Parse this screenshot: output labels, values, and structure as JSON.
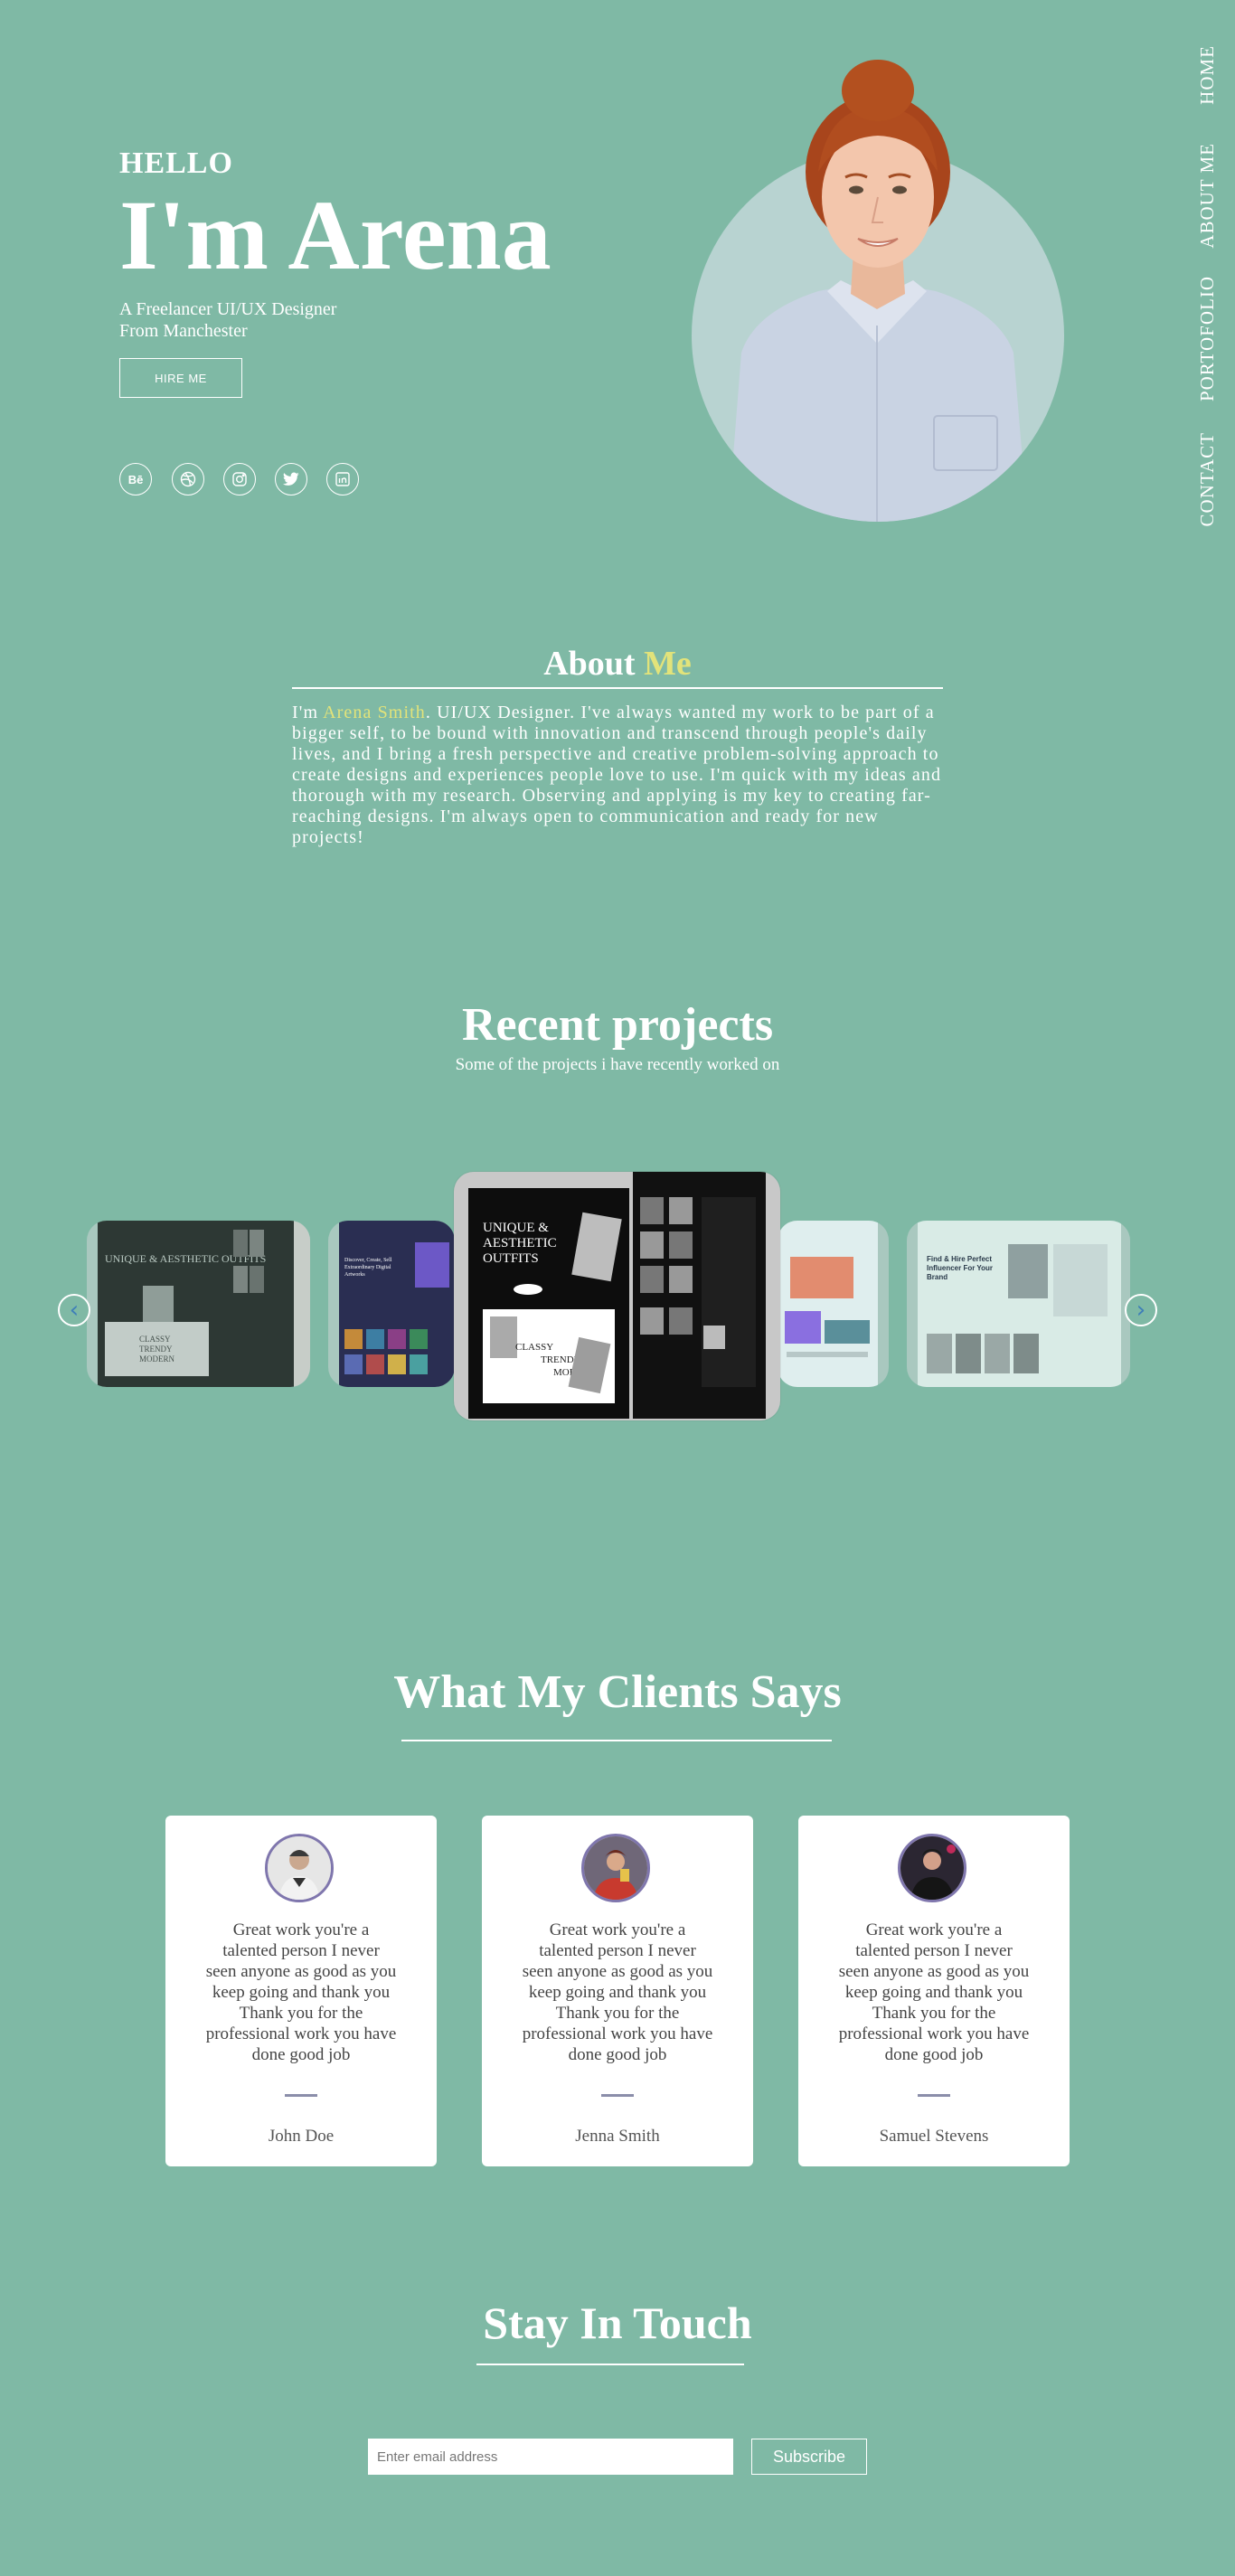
{
  "nav": {
    "items": [
      "HOME",
      "ABOUT ME",
      "PORTOFOLIO",
      "CONTACT"
    ]
  },
  "hero": {
    "greeting": "HELLO",
    "name": "I'm Arena",
    "subtitle_line1": "A Freelancer UI/UX Designer",
    "subtitle_line2": "From Manchester",
    "cta": "HIRE ME",
    "social": [
      {
        "icon": "behance-icon",
        "glyph": "Bē"
      },
      {
        "icon": "dribbble-icon",
        "glyph": ""
      },
      {
        "icon": "instagram-icon",
        "glyph": ""
      },
      {
        "icon": "twitter-icon",
        "glyph": ""
      },
      {
        "icon": "linkedin-icon",
        "glyph": ""
      }
    ]
  },
  "about": {
    "title_a": "About",
    "title_b": "Me",
    "text_prefix": "I'm ",
    "highlight_name": "Arena Smith",
    "text_body": ". UI/UX Designer. I've always wanted my work to be part of a bigger self, to be bound with innovation and transcend through people's daily lives, and I bring a fresh perspective and creative problem-solving approach to create designs and experiences people love to use. I'm quick with my ideas and thorough with my research. Observing and applying is my key to creating far-reaching designs. I'm always open to communication and ready for new projects!"
  },
  "projects": {
    "title": "Recent projects",
    "subtitle": "Some of the projects i have recently worked on",
    "cards": [
      {
        "id": "fashion-dark",
        "heading": "UNIQUE & AESTHETIC OUTFITS",
        "sub": "CLASSY TRENDY MODERN"
      },
      {
        "id": "creative-market",
        "heading": "Discover, Create, Sell Extraordinary Digital Artworks"
      },
      {
        "id": "fashion-featured",
        "heading": "UNIQUE & AESTHETIC OUTFITS",
        "sub1": "CLASSY",
        "sub2": "TRENDY",
        "sub3": "MODERN"
      },
      {
        "id": "saas-dashboard"
      },
      {
        "id": "influencer",
        "heading": "Find & Hire Perfect Influencer For Your Brand"
      }
    ],
    "prev_icon": "chevron-left-icon",
    "next_icon": "chevron-right-icon"
  },
  "testimonials": {
    "title": "What My Clients Says",
    "items": [
      {
        "name": "John Doe",
        "quote": "Great work you're a talented person I never seen anyone as good as you keep going and thank you Thank you for the professional work you have done good job"
      },
      {
        "name": "Jenna Smith",
        "quote": "Great work you're a talented person I never seen anyone as good as you keep going and thank you Thank you for the professional work you have done good job"
      },
      {
        "name": "Samuel Stevens",
        "quote": "Great work you're a talented person I never seen anyone as good as you keep going and thank you Thank you for the professional work you have done good job"
      }
    ]
  },
  "contact": {
    "title": "Stay In Touch",
    "email_placeholder": "Enter email address",
    "subscribe": "Subscribe"
  },
  "colors": {
    "background": "#7fb9a5",
    "accent": "#e2e37a",
    "avatar_ring": "#7f76ad"
  }
}
